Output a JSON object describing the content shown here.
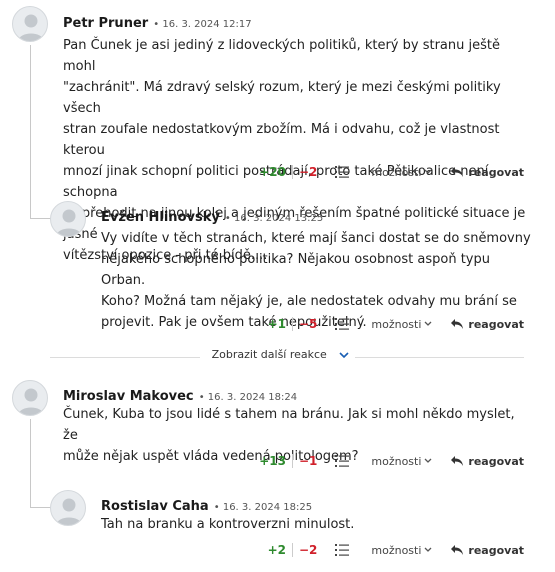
{
  "comments": [
    {
      "author": "Petr Pruner",
      "date": "• 16. 3. 2024 12:17",
      "lines": [
        "Pan Čunek je asi jediný z lidoveckých politiků, který by stranu ještě mohl",
        "\"zachránit\". Má zdravý selský rozum, který je mezi českými politiky všech",
        "stran zoufale nedostatkovým zbožím. Má i odvahu, což je vlastnost kterou",
        "mnozí jinak schopní politici postrádají, proto také Pětikoalice není schopna",
        "se přehodit na jinou kolej a jediným řešením špatné politické situace je jasné",
        "vítězství opozice - při té bídě...."
      ],
      "plus": "+20",
      "minus": "−2",
      "more": "možnosti",
      "reply": "reagovat"
    },
    {
      "author": "Evžen Hlinovský",
      "date": "• 16. 3. 2024 13:25",
      "lines": [
        "Vy vidíte v těch stranách, které mají šanci dostat se do sněmovny",
        "nějakého schopného politika? Nějakou osobnost aspoň typu Orban.",
        "Koho? Možná tam nějaký je, ale nedostatek odvahy mu brání se",
        "projevit. Pak je ovšem také nepoužitelný."
      ],
      "plus": "+1",
      "minus": "−5",
      "more": "možnosti",
      "reply": "reagovat"
    },
    {
      "author": "Miroslav Makovec",
      "date": "• 16. 3. 2024 18:24",
      "lines": [
        "Čunek, Kuba to jsou lidé s tahem na bránu. Jak si mohl někdo myslet, že",
        "může nějak uspět vláda vedená politologem?"
      ],
      "plus": "+13",
      "minus": "−1",
      "more": "možnosti",
      "reply": "reagovat"
    },
    {
      "author": "Rostislav Caha",
      "date": "• 16. 3. 2024 18:25",
      "lines": [
        "Tah na branku a kontroverzni minulost."
      ],
      "plus": "+2",
      "minus": "−2",
      "more": "možnosti",
      "reply": "reagovat"
    }
  ],
  "show_more_label": "Zobrazit další reakce",
  "colors": {
    "positive": "#2e8a2e",
    "negative": "#d0202a",
    "link": "#1a5fb4"
  },
  "icons": [
    "avatar-placeholder-icon",
    "list-icon",
    "chevron-down-icon",
    "reply-arrow-icon"
  ]
}
